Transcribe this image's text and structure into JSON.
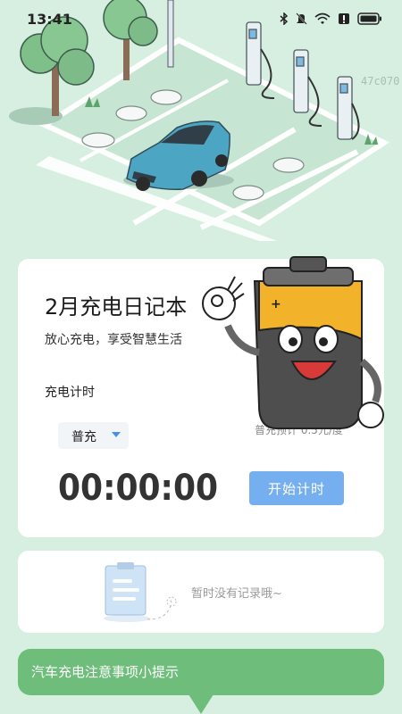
{
  "status_bar": {
    "time": "13:41",
    "icons": [
      "bluetooth-icon",
      "mute-icon",
      "wifi-icon",
      "alert-icon",
      "battery-icon"
    ]
  },
  "watermark": "47c070",
  "hero": {
    "illustration": "ev-charging-parking-illustration"
  },
  "main_card": {
    "title": "2月充电日记本",
    "subtitle": "放心充电，享受智慧生活",
    "timer_label": "充电计时",
    "mode_selected": "普充",
    "price_hint": "普充预计 0.5元/度",
    "timer_value": "00:00:00",
    "start_button": "开始计时"
  },
  "records_card": {
    "empty_text": "暂时没有记录哦~"
  },
  "tips": {
    "label": "汽车充电注意事项小提示"
  },
  "colors": {
    "background": "#d6efe1",
    "accent_button": "#75aff0",
    "tips_green": "#6fbd7a"
  }
}
